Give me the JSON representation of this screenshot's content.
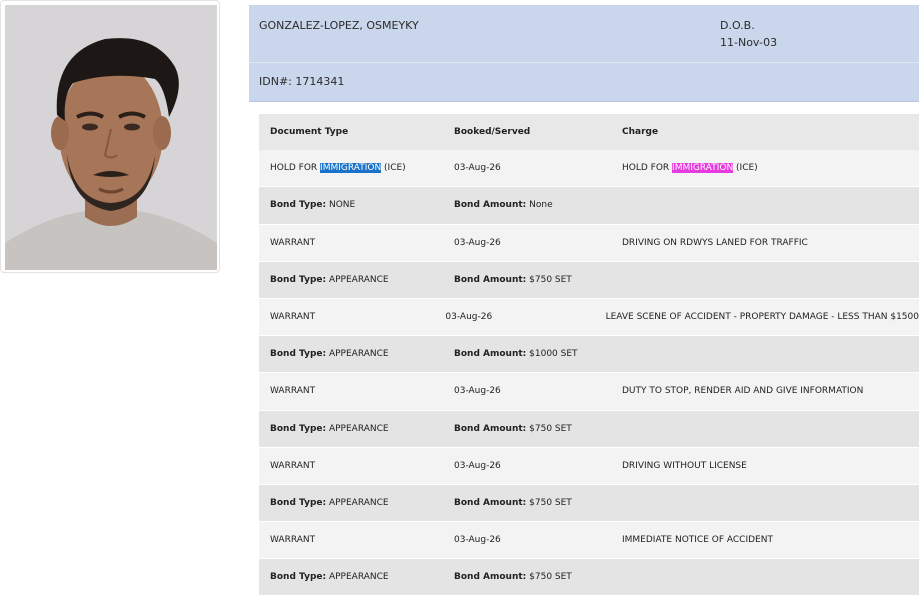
{
  "inmate": {
    "name": "GONZALEZ-LOPEZ, OSMEYKY",
    "dob_label": "D.O.B.",
    "dob": "11-Nov-03",
    "idn": "IDN#: 1714341"
  },
  "columns": [
    "Document Type",
    "Booked/Served",
    "Charge"
  ],
  "bond_type_label": "Bond Type:",
  "bond_amount_label": "Bond Amount:",
  "charges": [
    {
      "doc_before": "HOLD FOR ",
      "doc_highlight": "IMMIGRATION",
      "doc_after": " (ICE)",
      "date": "03-Aug-26",
      "charge_before": "HOLD FOR ",
      "charge_highlight": "IMMIGRATION",
      "charge_after": " (ICE)",
      "bond_type": " NONE",
      "bond_amount": " None"
    },
    {
      "doc_before": "WARRANT",
      "doc_highlight": "",
      "doc_after": "",
      "date": "03-Aug-26",
      "charge_before": "DRIVING ON RDWYS LANED FOR TRAFFIC",
      "charge_highlight": "",
      "charge_after": "",
      "bond_type": " APPEARANCE",
      "bond_amount": " $750 SET"
    },
    {
      "doc_before": "WARRANT",
      "doc_highlight": "",
      "doc_after": "",
      "date": "03-Aug-26",
      "charge_before": "LEAVE SCENE OF ACCIDENT - PROPERTY DAMAGE - LESS THAN $1500",
      "charge_highlight": "",
      "charge_after": "",
      "bond_type": " APPEARANCE",
      "bond_amount": " $1000 SET"
    },
    {
      "doc_before": "WARRANT",
      "doc_highlight": "",
      "doc_after": "",
      "date": "03-Aug-26",
      "charge_before": "DUTY TO STOP, RENDER AID AND GIVE INFORMATION",
      "charge_highlight": "",
      "charge_after": "",
      "bond_type": " APPEARANCE",
      "bond_amount": " $750 SET"
    },
    {
      "doc_before": "WARRANT",
      "doc_highlight": "",
      "doc_after": "",
      "date": "03-Aug-26",
      "charge_before": "DRIVING WITHOUT LICENSE",
      "charge_highlight": "",
      "charge_after": "",
      "bond_type": " APPEARANCE",
      "bond_amount": " $750 SET"
    },
    {
      "doc_before": "WARRANT",
      "doc_highlight": "",
      "doc_after": "",
      "date": "03-Aug-26",
      "charge_before": "IMMEDIATE NOTICE OF ACCIDENT",
      "charge_highlight": "",
      "charge_after": "",
      "bond_type": " APPEARANCE",
      "bond_amount": " $750 SET"
    }
  ],
  "colors": {
    "header_bg": "#c9d6eb",
    "highlight_blue": "#1a73c8",
    "highlight_magenta": "#e63bdc",
    "row_light": "#f3f3f3",
    "row_dark": "#e4e4e4"
  }
}
